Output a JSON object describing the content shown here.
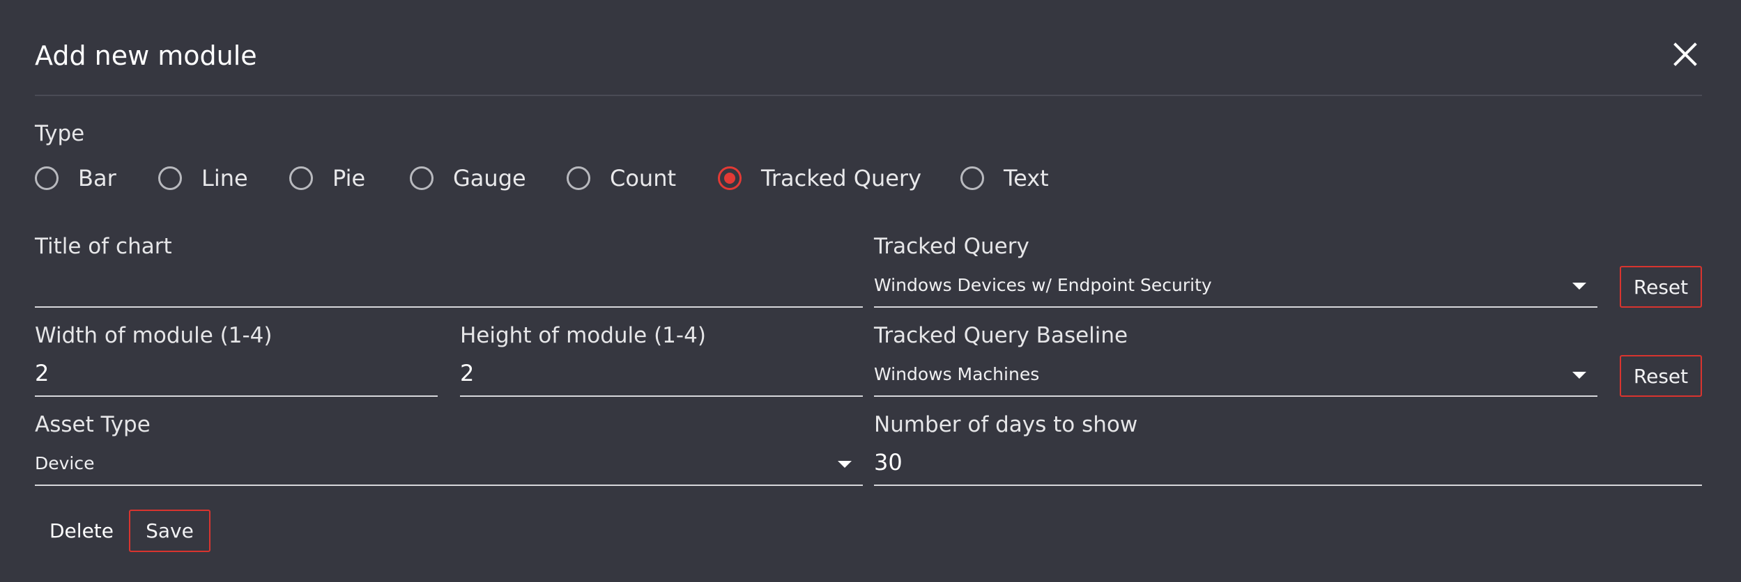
{
  "dialog": {
    "title": "Add new module",
    "close_icon": "close-icon"
  },
  "type": {
    "label": "Type",
    "options": [
      {
        "label": "Bar",
        "checked": false
      },
      {
        "label": "Line",
        "checked": false
      },
      {
        "label": "Pie",
        "checked": false
      },
      {
        "label": "Gauge",
        "checked": false
      },
      {
        "label": "Count",
        "checked": false
      },
      {
        "label": "Tracked Query",
        "checked": true
      },
      {
        "label": "Text",
        "checked": false
      }
    ]
  },
  "fields": {
    "title_of_chart": {
      "label": "Title of chart",
      "value": ""
    },
    "tracked_query": {
      "label": "Tracked Query",
      "value": "Windows Devices w/ Endpoint Security",
      "reset_label": "Reset"
    },
    "width": {
      "label": "Width of module (1-4)",
      "value": "2"
    },
    "height": {
      "label": "Height of module (1-4)",
      "value": "2"
    },
    "tracked_query_baseline": {
      "label": "Tracked Query Baseline",
      "value": "Windows Machines",
      "reset_label": "Reset"
    },
    "asset_type": {
      "label": "Asset Type",
      "value": "Device"
    },
    "days_to_show": {
      "label": "Number of days to show",
      "value": "30"
    }
  },
  "actions": {
    "delete_label": "Delete",
    "save_label": "Save"
  },
  "colors": {
    "background": "#363740",
    "accent": "#e33a35",
    "text": "#ffffff"
  }
}
